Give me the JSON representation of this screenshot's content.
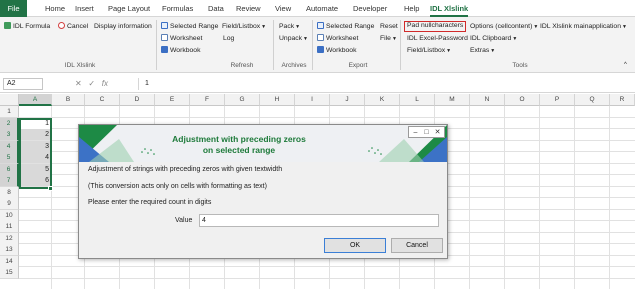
{
  "tabs": [
    "File",
    "Home",
    "Insert",
    "Page Layout",
    "Formulas",
    "Data",
    "Review",
    "View",
    "Automate",
    "Developer",
    "Help",
    "IDL Xlslink"
  ],
  "active_tab": "IDL Xlslink",
  "ribbon": {
    "idl_formula": "IDL Formula",
    "cancel": "Cancel",
    "display_information": "Display information",
    "group_idl_xlslink": "IDL Xlslink",
    "refresh_selected_range": "Selected Range",
    "field_listbox": "Field/Listbox",
    "refresh_worksheet": "Worksheet",
    "log": "Log",
    "refresh_workbook": "Workbook",
    "group_refresh": "Refresh",
    "pack": "Pack",
    "unpack": "Unpack",
    "group_archives": "Archives",
    "export_selected_range": "Selected Range",
    "reset": "Reset",
    "export_worksheet": "Worksheet",
    "file": "File",
    "export_workbook": "Workbook",
    "group_export": "Export",
    "pad_nullcharacters": "Pad nullcharacters",
    "options_cellcontent": "Options (cellcontent)",
    "idl_xlslink_mainapplication": "IDL Xlslink mainapplication",
    "idl_excel_password": "IDL Excel-Password",
    "idl_clipboard": "IDL Clipboard",
    "tools_field_listbox": "Field/Listbox",
    "extras": "Extras",
    "group_tools": "Tools"
  },
  "formula_bar": {
    "name_box": "A2",
    "fx_label": "fx",
    "value": "1"
  },
  "grid": {
    "columns": [
      "A",
      "B",
      "C",
      "D",
      "E",
      "F",
      "G",
      "H",
      "I",
      "J",
      "K",
      "L",
      "M",
      "N",
      "O",
      "P",
      "Q",
      "R"
    ],
    "rows": [
      "1",
      "2",
      "3",
      "4",
      "5",
      "6",
      "7",
      "8",
      "9",
      "10",
      "11",
      "12",
      "13",
      "14",
      "15"
    ],
    "column_a_values": [
      "1",
      "2",
      "3",
      "4",
      "5",
      "6"
    ],
    "selected_column": "A"
  },
  "dialog": {
    "title_line1": "Adjustment with preceding zeros",
    "title_line2": "on selected range",
    "description": "Adjustment of strings with preceding zeros with given textwidth",
    "note": "(This conversion acts only on cells with formatting as text)",
    "prompt": "Please enter the required count in digits",
    "value_label": "Value",
    "value": "4",
    "ok_label": "OK",
    "cancel_label": "Cancel"
  }
}
